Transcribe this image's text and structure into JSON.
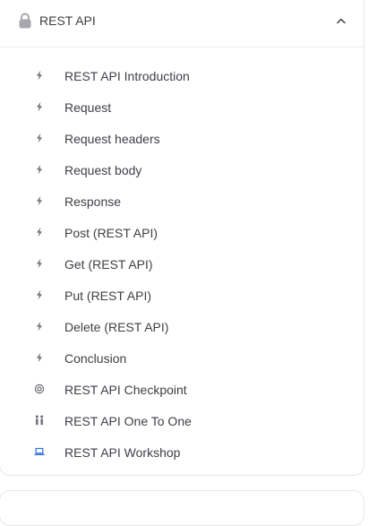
{
  "section": {
    "title": "REST API",
    "expanded": true,
    "items": [
      {
        "label": "REST API Introduction",
        "icon": "lightning-icon"
      },
      {
        "label": "Request",
        "icon": "lightning-icon"
      },
      {
        "label": "Request headers",
        "icon": "lightning-icon"
      },
      {
        "label": "Request body",
        "icon": "lightning-icon"
      },
      {
        "label": "Response",
        "icon": "lightning-icon"
      },
      {
        "label": "Post (REST API)",
        "icon": "lightning-icon"
      },
      {
        "label": "Get (REST API)",
        "icon": "lightning-icon"
      },
      {
        "label": "Put (REST API)",
        "icon": "lightning-icon"
      },
      {
        "label": "Delete (REST API)",
        "icon": "lightning-icon"
      },
      {
        "label": "Conclusion",
        "icon": "lightning-icon"
      },
      {
        "label": "REST API Checkpoint",
        "icon": "target-icon"
      },
      {
        "label": "REST API One To One",
        "icon": "people-icon"
      },
      {
        "label": "REST API Workshop",
        "icon": "laptop-icon"
      }
    ]
  },
  "colors": {
    "icon_gray": "#6b6b73",
    "icon_blue": "#2a6fdb",
    "lock_gray": "#a7a7ad",
    "border": "#e6e6e9"
  }
}
